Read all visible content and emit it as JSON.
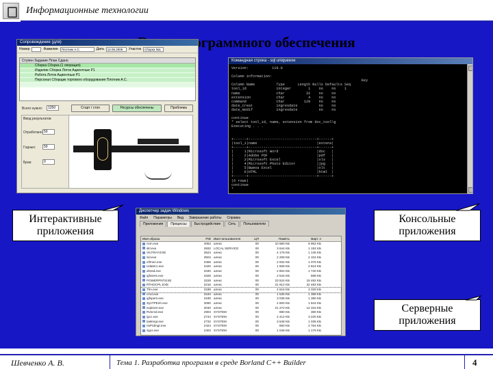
{
  "header": {
    "title": "Информационные технологии"
  },
  "slide": {
    "title": "Виды программного обеспечения"
  },
  "callouts": {
    "interactive": "Интерактивные приложения",
    "console": "Консольные приложения",
    "server": "Серверные приложения"
  },
  "interactive_app": {
    "window_title": "Сопровождение (для)",
    "menu": [
      "Номер",
      "ТЭ",
      "Фамилия",
      "Плотник А.С.",
      "Дата",
      "12.06.2006",
      "Участок",
      "Сборка №1"
    ],
    "grid_header": "Ступен Задание План Сдано",
    "grid_rows": [
      "Сборка  Сборка (1 операция)",
      "Изделие  Сборка Лоток Ациентные Р1",
      "Работа  Лоток Ациентные Р1",
      "Персонал  Сборщик торгового оборудования Плотник А.С."
    ],
    "labels": {
      "total": "Всего нужно:",
      "total_value": "1250",
      "start": "Старт / стоп",
      "resources": "Ресурсы обеспечены",
      "problem": "Проблема",
      "input_results": "Ввод результатов",
      "worked": "Отработано:",
      "good": "Годных:",
      "defect": "Брак:",
      "worked_value": "50",
      "good_value": "50",
      "defect_value": "0"
    }
  },
  "console_app": {
    "window_title": "Командная строка - sql uniqueexe",
    "lines": [
      "Version:           119.0",
      "",
      "Column information:",
      "                                                             Key",
      "Column Name          Type      Length Nulls Defaults Seq",
      "tool_id              integer        1    no    no    1",
      "name                 char          32    no    no",
      "extension            char           4    no    no",
      "command              char         128    no    no",
      "date_creat           ingresdate          no    no",
      "date_modif           ingresdate          no    no",
      "",
      "continue",
      "* select tool_id, name, extension from doc_tool\\g",
      "Executing . . .",
      "",
      "",
      "+------+--------------------------------+------+",
      "|tool_i|name                            |extens|",
      "+------+--------------------------------+------+",
      "|     1|Microsoft Word                  |doc   |",
      "|     2|Adobe PDF                       |pdf   |",
      "|     3|Microsoft Excel                 |xls   |",
      "|     4|Microsoft Photo Editor          |jpg   |",
      "|     5|Вывоа Excel                     |xlt   |",
      "|     6|HTML                            |html  |",
      "+------+--------------------------------+------+",
      "(6 rows)",
      "continue",
      "*"
    ]
  },
  "task_manager": {
    "window_title": "Диспетчер задач Windows",
    "menu": [
      "Файл",
      "Параметры",
      "Вид",
      "Завершение работы",
      "Справка"
    ],
    "tabs": [
      "Приложения",
      "Процессы",
      "Быстродействие",
      "Сеть",
      "Пользователи"
    ],
    "active_tab": 1,
    "columns": [
      "Имя образа",
      "PID",
      "Имя пользователя",
      "ЦП",
      "Память",
      "Вирт. п"
    ],
    "rows": [
      [
        "nvm.exe",
        "4064",
        "алекс",
        "00",
        "10 680 KБ",
        "6 952 KБ"
      ],
      [
        "skl.exe",
        "3932",
        "LOCAL SERVICE",
        "00",
        "3 644 KБ",
        "1 192 KБ"
      ],
      [
        "VILTRAY.EXE",
        "3524",
        "алекс",
        "00",
        "4 176 KБ",
        "1 145 KБ"
      ],
      [
        "Sd.exe",
        "3504",
        "алекс",
        "00",
        "2 208 KБ",
        "2 104 KБ"
      ],
      [
        "ctfmon.exe",
        "3456",
        "алекс",
        "00",
        "2 932 KБ",
        "1 076 KБ"
      ],
      [
        "Udater1.exe",
        "3420",
        "алекс",
        "00",
        "1 508 KБ",
        "2 824 KБ"
      ],
      [
        "ahssd.exe",
        "3340",
        "алекс",
        "00",
        "2 804 KБ",
        "1 740 KБ"
      ],
      [
        "igfxsers.exe",
        "3328",
        "алекс",
        "00",
        "2 544 KБ",
        "688 KБ"
      ],
      [
        "POWERPNT.EXE",
        "3228",
        "алекс",
        "00",
        "23 524 KБ",
        "15 492 KБ"
      ],
      [
        "RTHDCPL.EXE",
        "3216",
        "алекс",
        "00",
        "21 912 KБ",
        "22 492 KБ"
      ],
      [
        "Thn.exe",
        "3188",
        "алекс",
        "00",
        "4 616 KБ",
        "3 328 KБ"
      ],
      [
        "cmd.exe",
        "3184",
        "алекс",
        "00",
        "1 536 KБ",
        "1 388 KБ"
      ],
      [
        "igfxpers.exe",
        "3180",
        "алекс",
        "00",
        "3 036 KБ",
        "1 380 KБ"
      ],
      [
        "SynTPEnh.exe",
        "3060",
        "алекс",
        "00",
        "4 600 KБ",
        "1 844 KБ"
      ],
      [
        "explorer.exe",
        "3040",
        "алекс",
        "00",
        "21 272 KБ",
        "12 316 KБ"
      ],
      [
        "Rvtcmd.exe",
        "2904",
        "SYSTEM",
        "00",
        "880 KБ",
        "380 KБ"
      ],
      [
        "igcc.exe",
        "2744",
        "SYSTEM",
        "00",
        "4 412 KБ",
        "3 220 KБ"
      ],
      [
        "taskmgr.exe",
        "2732",
        "SYSTEM",
        "00",
        "3 648 KБ",
        "1 036 KБ"
      ],
      [
        "nsPrdmgr.exe",
        "2424",
        "SYSTEM",
        "00",
        "860 KБ",
        "2 764 KБ"
      ],
      [
        "Sgcr.exe",
        "2404",
        "SYSTEM",
        "00",
        "1 048 KБ",
        "1 176 KБ"
      ]
    ],
    "selected_row": 10
  },
  "footer": {
    "author": "Шевченко А. В.",
    "topic": "Тема 1. Разработка программ в среде Borland C++ Builder",
    "page": "4"
  }
}
